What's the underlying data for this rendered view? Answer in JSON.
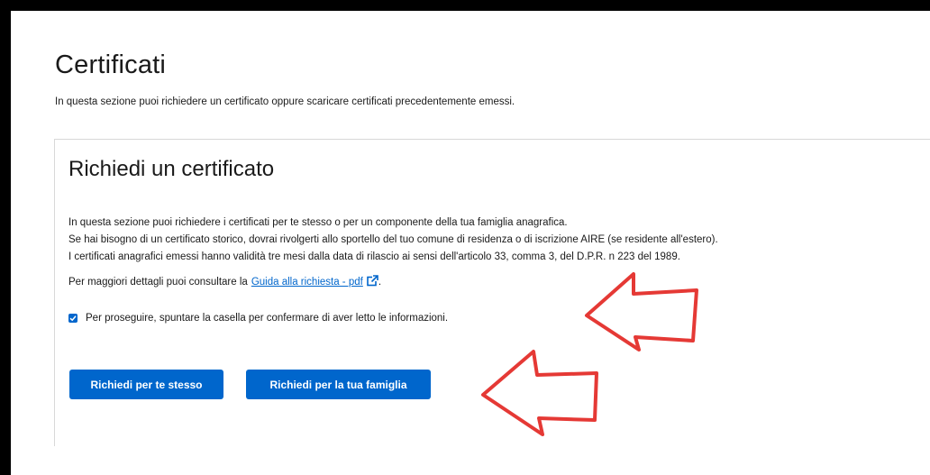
{
  "page": {
    "title": "Certificati",
    "description": "In questa sezione puoi richiedere un certificato oppure scaricare certificati precedentemente emessi."
  },
  "card": {
    "title": "Richiedi un certificato",
    "info_lines": [
      "In questa sezione puoi richiedere i certificati per te stesso o per un componente della tua famiglia anagrafica.",
      "Se hai bisogno di un certificato storico, dovrai rivolgerti allo sportello del tuo comune di residenza o di iscrizione AIRE (se residente all'estero).",
      "I certificati anagrafici emessi hanno validità tre mesi dalla data di rilascio ai sensi dell'articolo 33, comma 3, del D.P.R. n 223 del 1989."
    ],
    "guide_prefix": "Per maggiori dettagli puoi consultare la",
    "guide_link": "Guida alla richiesta - pdf",
    "guide_suffix": ".",
    "confirm_label": "Per proseguire, spuntare la casella per confermare di aver letto le informazioni.",
    "confirm_checked": true
  },
  "buttons": {
    "self": "Richiedi per te stesso",
    "family": "Richiedi per la tua famiglia"
  },
  "colors": {
    "accent": "#0066cc",
    "annotation_arrow": "#e53935"
  },
  "icons": {
    "external_link": "external-link-icon",
    "check": "check-icon",
    "annotation": "arrow-left-annotation"
  }
}
